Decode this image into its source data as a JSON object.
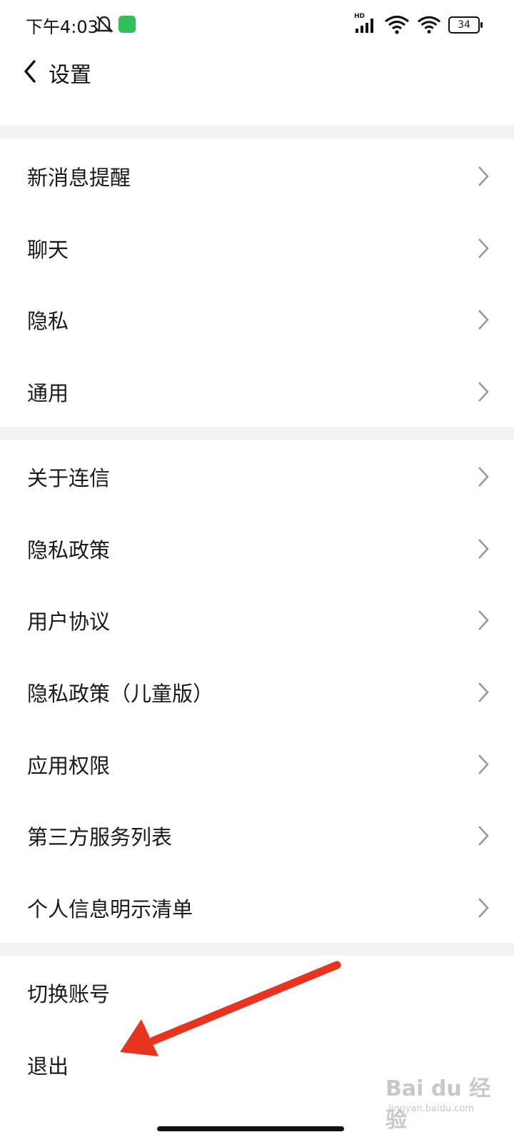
{
  "status_bar": {
    "time": "下午4:03",
    "network_label": "HD",
    "battery": "34",
    "icons": [
      "bell-muted-icon",
      "app-notification-icon",
      "signal-icon",
      "wifi-icon",
      "wifi-icon",
      "battery-icon"
    ]
  },
  "nav": {
    "back_icon": "chevron-left-icon",
    "title": "设置"
  },
  "groups": [
    {
      "items": [
        {
          "label": "新消息提醒"
        },
        {
          "label": "聊天"
        },
        {
          "label": "隐私"
        },
        {
          "label": "通用"
        }
      ]
    },
    {
      "items": [
        {
          "label": "关于连信"
        },
        {
          "label": "隐私政策"
        },
        {
          "label": "用户协议"
        },
        {
          "label": "隐私政策（儿童版）"
        },
        {
          "label": "应用权限"
        },
        {
          "label": "第三方服务列表"
        },
        {
          "label": "个人信息明示清单"
        }
      ]
    },
    {
      "items": [
        {
          "label": "切换账号"
        },
        {
          "label": "退出"
        }
      ]
    }
  ],
  "annotation_color": "#e8341f",
  "watermark": {
    "main": "Bai du 经验",
    "sub": "jingyan.baidu.com"
  }
}
